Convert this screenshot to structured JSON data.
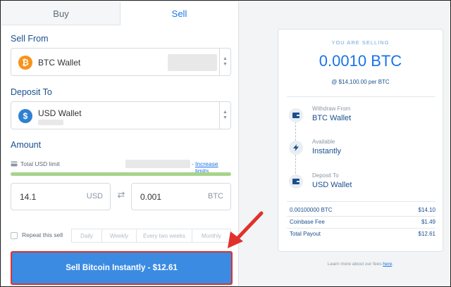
{
  "tabs": [
    {
      "label": "Buy",
      "active": false
    },
    {
      "label": "Sell",
      "active": true
    }
  ],
  "sell_from": {
    "label": "Sell From",
    "selected": "BTC Wallet",
    "coin_glyph": "₿",
    "coin_color": "#f7931a"
  },
  "deposit_to": {
    "label": "Deposit To",
    "selected": "USD Wallet",
    "coin_glyph": "$",
    "coin_color": "#2f80d1"
  },
  "amount": {
    "label": "Amount",
    "limit_label": "Total USD limit",
    "limit_link_prefix": "-",
    "increase_link": "Increase limits",
    "limit_used_fraction": 1.0,
    "fiat_value": "14.1",
    "fiat_unit": "USD",
    "crypto_value": "0.001",
    "crypto_unit": "BTC"
  },
  "repeat": {
    "label": "Repeat this sell",
    "checked": false,
    "options": [
      "Daily",
      "Weekly",
      "Every two weeks",
      "Monthly"
    ]
  },
  "sell_button": "Sell Bitcoin Instantly - $12.61",
  "summary": {
    "caption": "YOU ARE SELLING",
    "amount": "0.0010 BTC",
    "price": "@ $14,100.00 per BTC",
    "steps": [
      {
        "label": "Withdraw From",
        "value": "BTC Wallet",
        "icon": "wallet-icon"
      },
      {
        "label": "Available",
        "value": "Instantly",
        "icon": "lightning-icon"
      },
      {
        "label": "Deposit To",
        "value": "USD Wallet",
        "icon": "wallet-icon"
      }
    ],
    "fees": [
      {
        "label": "0.00100000 BTC",
        "value": "$14.10"
      },
      {
        "label": "Coinbase Fee",
        "value": "$1.49"
      },
      {
        "label": "Total Payout",
        "value": "$12.61"
      }
    ]
  },
  "learn_more": {
    "text": "Learn more about our fees",
    "link": "here",
    "suffix": "."
  },
  "colors": {
    "accent": "#1a73e8",
    "button": "#3b8be3",
    "highlight": "#e0312b",
    "progress": "#a6d48a"
  }
}
